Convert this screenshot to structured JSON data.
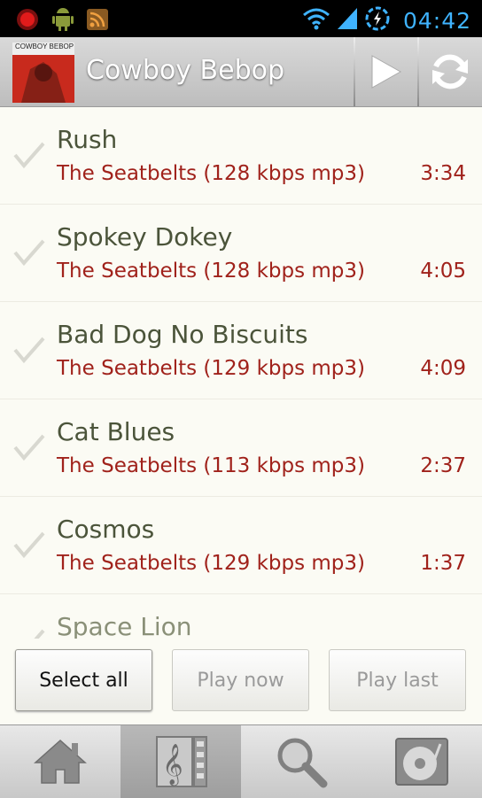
{
  "status_bar": {
    "time": "04:42"
  },
  "header": {
    "title": "Cowboy Bebop",
    "album_art_caption": "COWBOY BEBOP"
  },
  "songs": [
    {
      "title": "Rush",
      "artist": "The Seatbelts (128 kbps mp3)",
      "duration": "3:34"
    },
    {
      "title": "Spokey Dokey",
      "artist": "The Seatbelts (128 kbps mp3)",
      "duration": "4:05"
    },
    {
      "title": "Bad Dog No Biscuits",
      "artist": "The Seatbelts (129 kbps mp3)",
      "duration": "4:09"
    },
    {
      "title": "Cat Blues",
      "artist": "The Seatbelts (113 kbps mp3)",
      "duration": "2:37"
    },
    {
      "title": "Cosmos",
      "artist": "The Seatbelts (129 kbps mp3)",
      "duration": "1:37"
    },
    {
      "title": "Space Lion",
      "artist": "",
      "duration": ""
    }
  ],
  "buttons": {
    "select_all": "Select all",
    "play_now": "Play now",
    "play_last": "Play last"
  },
  "nav": {
    "selected": "library"
  },
  "colors": {
    "accent_time": "#3fb3ff",
    "artist_text": "#a0221b",
    "title_text": "#4b543a"
  }
}
